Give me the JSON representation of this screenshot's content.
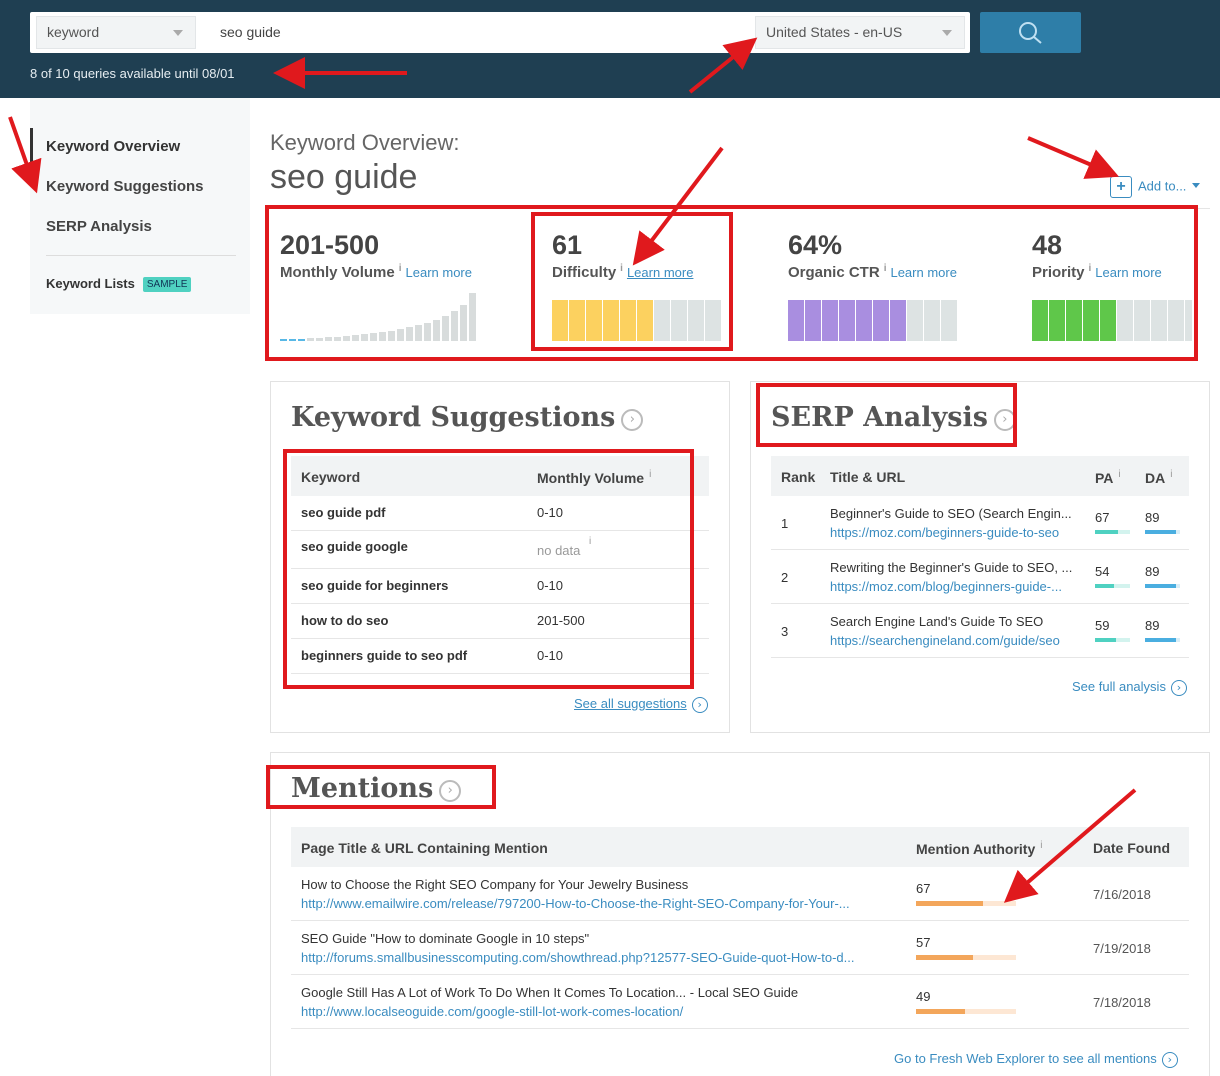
{
  "search": {
    "mode": "keyword",
    "query": "seo guide",
    "locale": "United States - en-US",
    "quota": "8 of 10 queries available until 08/01"
  },
  "sidebar": {
    "items": [
      {
        "label": "Keyword Overview"
      },
      {
        "label": "Keyword Suggestions"
      },
      {
        "label": "SERP Analysis"
      }
    ],
    "lists_label": "Keyword Lists",
    "sample_badge": "SAMPLE"
  },
  "header": {
    "title": "Keyword Overview:",
    "keyword": "seo guide",
    "add_to": "Add to..."
  },
  "metrics": {
    "info": "i",
    "volume": {
      "value": "201-500",
      "label": "Monthly Volume",
      "learn": "Learn more"
    },
    "difficulty": {
      "value": "61",
      "label": "Difficulty",
      "learn": "Learn more",
      "filled": 6,
      "total": 10,
      "color": "#fcd15f"
    },
    "ctr": {
      "value": "64%",
      "label": "Organic CTR",
      "learn": "Learn more",
      "filled": 7,
      "total": 10,
      "color": "#a98ee0"
    },
    "priority": {
      "value": "48",
      "label": "Priority",
      "learn": "Learn more",
      "filled": 5,
      "total": 10,
      "color": "#5fc74a"
    }
  },
  "suggestions": {
    "title": "Keyword Suggestions",
    "col_keyword": "Keyword",
    "col_volume": "Monthly Volume",
    "rows": [
      {
        "keyword": "seo guide pdf",
        "volume": "0-10"
      },
      {
        "keyword": "seo guide google",
        "volume": "no data"
      },
      {
        "keyword": "seo guide for beginners",
        "volume": "0-10"
      },
      {
        "keyword": "how to do seo",
        "volume": "201-500"
      },
      {
        "keyword": "beginners guide to seo pdf",
        "volume": "0-10"
      }
    ],
    "see_all": "See all suggestions"
  },
  "serp": {
    "title": "SERP Analysis",
    "col_rank": "Rank",
    "col_title": "Title & URL",
    "col_pa": "PA",
    "col_da": "DA",
    "rows": [
      {
        "rank": "1",
        "title": "Beginner's Guide to SEO (Search Engin...",
        "url": "https://moz.com/beginners-guide-to-seo",
        "pa": "67",
        "da": "89"
      },
      {
        "rank": "2",
        "title": "Rewriting the Beginner's Guide to SEO, ...",
        "url": "https://moz.com/blog/beginners-guide-...",
        "pa": "54",
        "da": "89"
      },
      {
        "rank": "3",
        "title": "Search Engine Land's Guide To SEO",
        "url": "https://searchengineland.com/guide/seo",
        "pa": "59",
        "da": "89"
      }
    ],
    "see_full": "See full analysis"
  },
  "mentions": {
    "title": "Mentions",
    "col_page": "Page Title & URL Containing Mention",
    "col_authority": "Mention Authority",
    "col_date": "Date Found",
    "rows": [
      {
        "title": "How to Choose the Right SEO Company for Your Jewelry Business",
        "url": "http://www.emailwire.com/release/797200-How-to-Choose-the-Right-SEO-Company-for-Your-...",
        "authority": "67",
        "date": "7/16/2018"
      },
      {
        "title": "SEO Guide \"How to dominate Google in 10 steps\"",
        "url": "http://forums.smallbusinesscomputing.com/showthread.php?12577-SEO-Guide-quot-How-to-d...",
        "authority": "57",
        "date": "7/19/2018"
      },
      {
        "title": "Google Still Has A Lot of Work To Do When It Comes To Location... - Local SEO Guide",
        "url": "http://www.localseoguide.com/google-still-lot-work-comes-location/",
        "authority": "49",
        "date": "7/18/2018"
      }
    ],
    "footer": "Go to Fresh Web Explorer to see all mentions"
  },
  "colors": {
    "accent": "#3a8cc0",
    "annotation": "#e0191d",
    "topbar": "#1f3f52"
  }
}
